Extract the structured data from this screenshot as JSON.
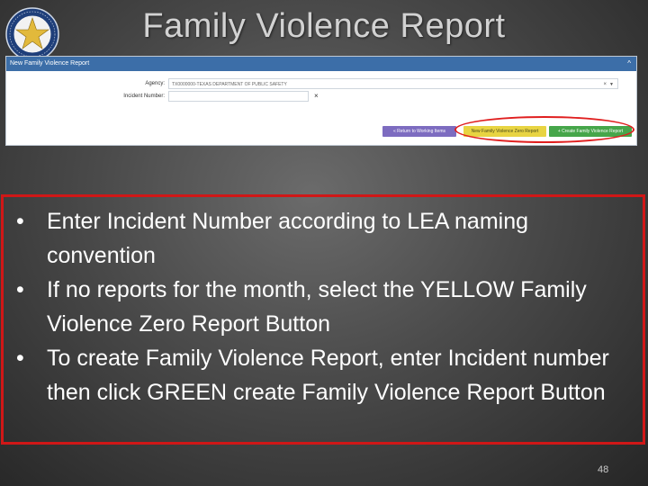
{
  "slide": {
    "title": "Family Violence Report",
    "page_number": "48"
  },
  "app": {
    "panel_title": "New Family Violence Report",
    "collapse_glyph": "^",
    "form": {
      "agency_label": "Agency:",
      "agency_value": "TX0000000-TEXAS DEPARTMENT OF PUBLIC SAFETY",
      "incident_label": "Incident Number:",
      "incident_value": "",
      "clear_glyph": "×"
    },
    "buttons": {
      "back": "« Return to Working Items",
      "zero": "New Family Violence Zero Report",
      "create": "+ Create Family Violence Report"
    },
    "colors": {
      "header": "#3c6ea8",
      "back_button": "#7d6cc0",
      "zero_button": "#e8d442",
      "create_button": "#46a64a",
      "highlight": "#e01f1f"
    }
  },
  "bullets": [
    "Enter Incident Number according to LEA naming convention",
    "If no reports for the month, select the YELLOW Family Violence Zero Report Button",
    "To create Family Violence Report, enter Incident number then click GREEN create Family Violence Report Button"
  ]
}
